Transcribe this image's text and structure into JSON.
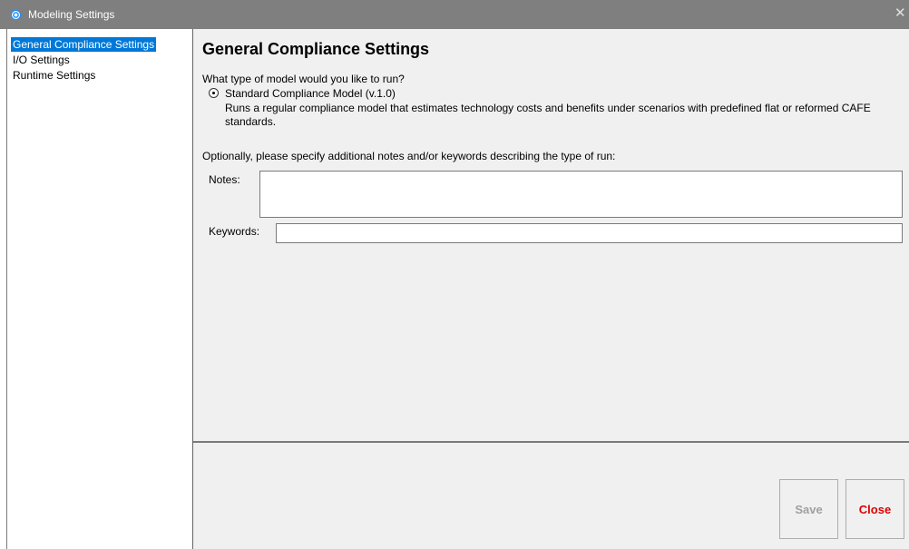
{
  "window": {
    "title": "Modeling Settings",
    "close_glyph": "✕",
    "icon": "gear-icon"
  },
  "sidebar": {
    "items": [
      {
        "label": "General Compliance Settings",
        "selected": true
      },
      {
        "label": "I/O Settings",
        "selected": false
      },
      {
        "label": "Runtime Settings",
        "selected": false
      }
    ]
  },
  "main": {
    "title": "General Compliance Settings",
    "question": "What type of model would you like to run?",
    "model_option": {
      "label": "Standard Compliance Model (v.1.0)",
      "description": "Runs a regular compliance model that estimates technology costs and benefits under scenarios with predefined flat or reformed CAFE standards.",
      "checked": true
    },
    "optional_text": "Optionally, please specify additional notes and/or keywords describing the type of run:",
    "notes_label": "Notes:",
    "notes_value": "",
    "keywords_label": "Keywords:",
    "keywords_value": ""
  },
  "footer": {
    "save_label": "Save",
    "close_label": "Close",
    "save_enabled": false
  },
  "colors": {
    "titlebar": "#7f7f7f",
    "selection": "#0078d7",
    "close_text": "#e00000",
    "disabled_text": "#a0a0a0",
    "panel_bg": "#f0f0f0"
  }
}
